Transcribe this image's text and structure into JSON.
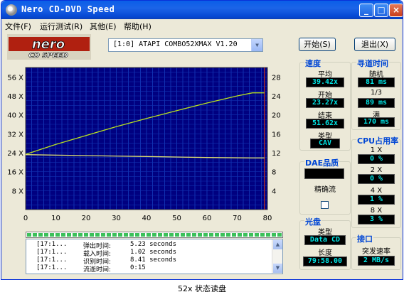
{
  "window": {
    "title": "Nero CD-DVD Speed"
  },
  "titlebar_buttons": {
    "minimize": "_",
    "maximize": "□",
    "close": "×"
  },
  "menu": [
    {
      "label": "文件(F)"
    },
    {
      "label": "运行测试(R)"
    },
    {
      "label": "其他(E)"
    },
    {
      "label": "帮助(H)"
    }
  ],
  "logo": {
    "line1": "nero",
    "line2": "CD SPEED"
  },
  "toolbar": {
    "drive": "[1:0]    ATAPI COMBO52XMAX V1.20",
    "start_label": "开始(S)",
    "exit_label": "退出(X)"
  },
  "chart_data": {
    "type": "line",
    "x_ticks": [
      "0",
      "10",
      "20",
      "30",
      "40",
      "50",
      "60",
      "70",
      "80"
    ],
    "y_left_ticks": [
      "8 X",
      "16 X",
      "24 X",
      "32 X",
      "40 X",
      "48 X",
      "56 X"
    ],
    "y_right_ticks": [
      "4",
      "8",
      "12",
      "16",
      "20",
      "24",
      "28"
    ],
    "xlim": [
      0,
      80
    ],
    "ylim_left": [
      0,
      60
    ],
    "ylim_right": [
      0,
      30
    ],
    "grid": true,
    "colors": {
      "background": "#000080",
      "grid": "#1030b0",
      "speed": "#b8e020",
      "seek": "#e0e070",
      "marker": "#c03020"
    },
    "series": [
      {
        "x": [
          0,
          10,
          20,
          30,
          40,
          50,
          60,
          70,
          75,
          79
        ],
        "y": [
          23.3,
          27.5,
          31.3,
          35.0,
          38.5,
          41.8,
          45.0,
          48.0,
          49.3,
          49.3
        ]
      },
      {
        "x": [
          0,
          20,
          40,
          60,
          75,
          79
        ],
        "y": [
          23.2,
          22.8,
          22.4,
          22.0,
          21.8,
          21.8
        ]
      }
    ],
    "end_marker_x": 79
  },
  "progress": {
    "fraction": 1.0
  },
  "log": [
    {
      "time": "[17:1...",
      "label": "弹出时间:",
      "value": "5.23 seconds"
    },
    {
      "time": "[17:1...",
      "label": "载入时间:",
      "value": "1.02 seconds"
    },
    {
      "time": "[17:1...",
      "label": "识别时间:",
      "value": "8.41 seconds"
    },
    {
      "time": "[17:1...",
      "label": "流逝时间:",
      "value": "0:15"
    }
  ],
  "speed_panel": {
    "title": "速度",
    "avg_label": "平均",
    "avg": "39.42x",
    "start_label": "开始",
    "start": "23.27x",
    "end_label": "结束",
    "end": "51.62x",
    "type_label": "类型",
    "type": "CAV"
  },
  "seek_panel": {
    "title": "寻道时间",
    "random_label": "随机",
    "random": "81 ms",
    "third_label": "1/3",
    "third": "89 ms",
    "full_label": "满",
    "full": "170 ms"
  },
  "dae_panel": {
    "title": "DAE品质",
    "accurate_label": "精确流"
  },
  "cpu_panel": {
    "title": "CPU占用率",
    "rows": [
      {
        "label": "1 X",
        "value": "0 %"
      },
      {
        "label": "2 X",
        "value": "0 %"
      },
      {
        "label": "4 X",
        "value": "1 %"
      },
      {
        "label": "8 X",
        "value": "3 %"
      }
    ]
  },
  "disc_panel": {
    "title": "光盘",
    "type_label": "类型",
    "type": "Data CD",
    "length_label": "长度",
    "length": "79:58.00"
  },
  "interface_panel": {
    "title": "接口",
    "burst_label": "突发速率",
    "burst": "2 MB/s"
  },
  "caption": "52x 状态读盘"
}
